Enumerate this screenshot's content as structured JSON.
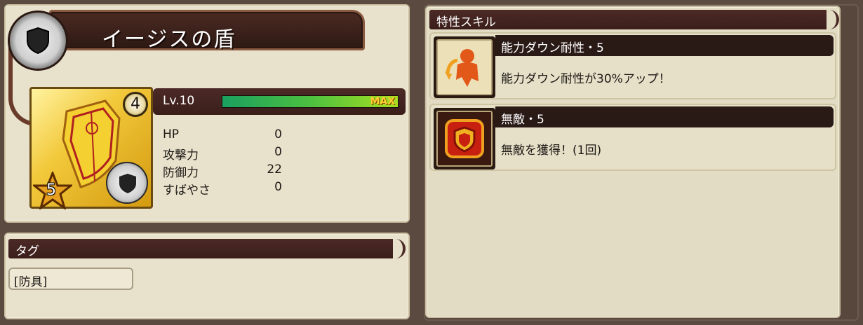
{
  "item": {
    "name": "イージスの盾",
    "level_label": "Lv.10",
    "exp_fraction": 1.0,
    "max_label": "MAX",
    "grade": "4",
    "rarity": "5"
  },
  "stats": [
    {
      "label": "HP",
      "value": "0"
    },
    {
      "label": "攻撃力",
      "value": "0"
    },
    {
      "label": "防御力",
      "value": "22"
    },
    {
      "label": "すばやさ",
      "value": "0"
    }
  ],
  "tags": {
    "header": "タグ",
    "items": [
      "[防具]"
    ]
  },
  "skills": {
    "header": "特性スキル",
    "items": [
      {
        "name": "能力ダウン耐性・5",
        "desc": "能力ダウン耐性が30%アップ！",
        "icon": "resist-down-icon"
      },
      {
        "name": "無敵・5",
        "desc": "無敵を獲得！(1回)",
        "icon": "invincible-icon"
      }
    ]
  },
  "colors": {
    "panel_bg": "#e8e2cc",
    "header_bg": "#3a1e1a",
    "card_gold": "#f2c83a",
    "exp_green": "#4cc040"
  }
}
